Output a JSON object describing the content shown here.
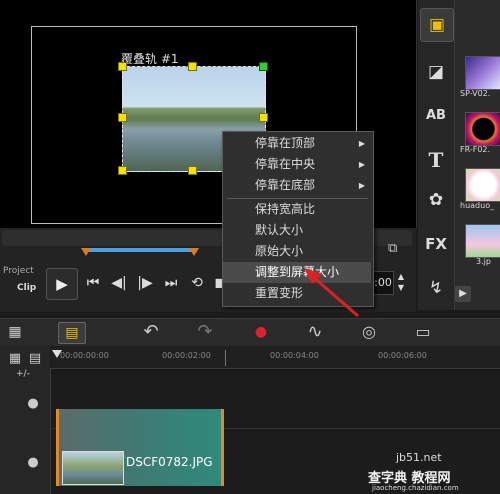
{
  "preview": {
    "overlay_label": "覆叠轨 #1"
  },
  "controls": {
    "project_label": "Project",
    "clip_label": "Clip",
    "play_icon": "▶",
    "start_icon": "⏮",
    "prev_frame_icon": "◀|",
    "next_frame_icon": "|▶",
    "end_icon": "⏭",
    "repeat_icon": "⟲",
    "volume_icon": "◼",
    "timecode": ":00",
    "spin_up": "▲",
    "spin_down": "▼",
    "split_icon": "⧉"
  },
  "tools": {
    "media_icon": "▣",
    "instant_project_icon": "◪",
    "transition_label": "AB",
    "title_label": "T",
    "graphic_icon": "✿",
    "fx_label": "FX",
    "path_icon": "↯"
  },
  "library": {
    "items": [
      {
        "name": "SP-V02."
      },
      {
        "name": "FR-F02."
      },
      {
        "name": "huaduo_"
      },
      {
        "name": "3.jp"
      }
    ],
    "scroll_right": "▶"
  },
  "context_menu": {
    "items": [
      {
        "label": "停靠在顶部",
        "submenu": "▶"
      },
      {
        "label": "停靠在中央",
        "submenu": "▶"
      },
      {
        "label": "停靠在底部",
        "submenu": "▶"
      },
      {
        "label": "保持宽高比"
      },
      {
        "label": "默认大小"
      },
      {
        "label": "原始大小"
      },
      {
        "label": "调整到屏幕大小"
      },
      {
        "label": "重置变形"
      }
    ]
  },
  "timeline": {
    "toolbar_icons": [
      "film-strip-icon",
      "storyboard-icon",
      "undo-icon",
      "redo-icon",
      "record-icon",
      "audio-wave-icon",
      "auto-music-icon",
      "subtitle-icon"
    ],
    "film_icon": "▦",
    "storyboard_icon": "▤",
    "undo_icon": "↶",
    "redo_icon": "↷",
    "record_icon": "●",
    "audio_icon": "∿",
    "music_icon": "◎",
    "subtitle_icon": "▭",
    "expand_label": "+/-",
    "timecodes": [
      "00:00:00:00",
      "00:00:02:00",
      "00:00:04:00",
      "00:00:06:00"
    ],
    "clip_name": "DSCF0782.JPG"
  },
  "watermark": {
    "line1": "jb51.net",
    "line2": "查字典 教程网",
    "line3": "jiaocheng.chazidian.com"
  }
}
